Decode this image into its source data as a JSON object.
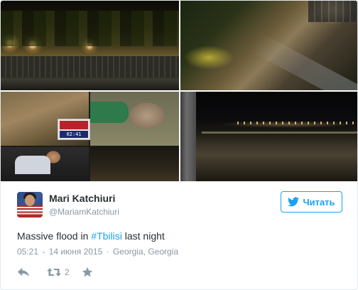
{
  "media": {
    "tiles": [
      {
        "name": "flood-street-night"
      },
      {
        "name": "flood-river-aerial"
      },
      {
        "name": "flood-rescue-collage"
      },
      {
        "name": "flood-river-dark"
      }
    ],
    "tv_overlay_time": "02:41"
  },
  "author": {
    "display_name": "Mari Katchiuri",
    "handle": "@MariamKatchiuri"
  },
  "follow_button": {
    "label": "Читать",
    "icon": "twitter-bird-icon",
    "color": "#1da1f2"
  },
  "tweet": {
    "text_before": "Massive flood in ",
    "hashtag": "#Tbilisi",
    "text_after": " last night"
  },
  "meta": {
    "time": "05:21",
    "separator": "-",
    "date": "14 июня 2015",
    "location_separator": "·",
    "location": "Georgia, Georgia"
  },
  "actions": {
    "reply_icon": "reply-icon",
    "retweet_icon": "retweet-icon",
    "retweet_count": "2",
    "like_icon": "star-icon"
  }
}
